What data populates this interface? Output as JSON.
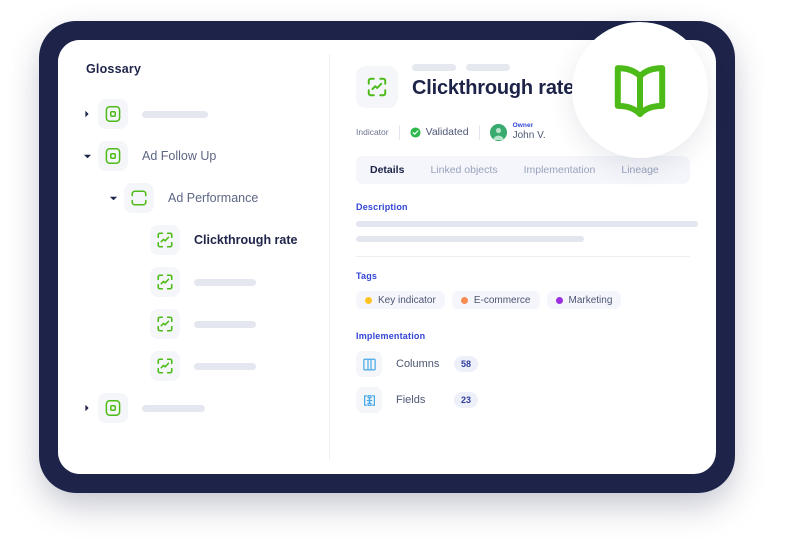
{
  "window": {
    "frame_color": "#1e2449",
    "surface_color": "#ffffff"
  },
  "badge": {
    "icon": "open-book-icon",
    "icon_color": "#4cbb17"
  },
  "sidebar": {
    "title": "Glossary",
    "items": [
      {
        "label": "",
        "icon": "domain-square-icon",
        "level": 0,
        "caret": "right",
        "skeleton_width": 66,
        "active": false
      },
      {
        "label": "Ad Follow Up",
        "icon": "domain-square-icon",
        "level": 0,
        "caret": "down",
        "skeleton_width": 0,
        "active": false
      },
      {
        "label": "Ad Performance",
        "icon": "rounded-frame-icon",
        "level": 1,
        "caret": "down",
        "skeleton_width": 0,
        "active": false
      },
      {
        "label": "Clickthrough rate",
        "icon": "indicator-scan-icon",
        "level": 2,
        "caret": "none",
        "skeleton_width": 0,
        "active": true
      },
      {
        "label": "",
        "icon": "indicator-scan-icon",
        "level": 2,
        "caret": "none",
        "skeleton_width": 62,
        "active": false
      },
      {
        "label": "",
        "icon": "indicator-scan-icon",
        "level": 2,
        "caret": "none",
        "skeleton_width": 62,
        "active": false
      },
      {
        "label": "",
        "icon": "indicator-scan-icon",
        "level": 2,
        "caret": "none",
        "skeleton_width": 62,
        "active": false
      },
      {
        "label": "",
        "icon": "domain-square-icon",
        "level": 0,
        "caret": "right",
        "skeleton_width": 63,
        "active": false
      }
    ],
    "icon_color": "#4cbb17"
  },
  "entity": {
    "icon": "indicator-scan-icon",
    "breadcrumb_skeletons": [
      44,
      44
    ],
    "title": "Clickthrough rate",
    "type_label": "Indicator",
    "status_label": "Validated",
    "status_color": "#2db84c",
    "owner_label": "Owner",
    "owner_name": "John V.",
    "owner_label_color": "#2f46d8"
  },
  "tabs": [
    {
      "label": "Details",
      "active": true
    },
    {
      "label": "Linked objects",
      "active": false
    },
    {
      "label": "Implementation",
      "active": false
    },
    {
      "label": "Lineage",
      "active": false
    }
  ],
  "description": {
    "label": "Description",
    "lines": [
      342,
      228
    ]
  },
  "tags": {
    "label": "Tags",
    "items": [
      {
        "label": "Key indicator",
        "color": "#ffc324"
      },
      {
        "label": "E-commerce",
        "color": "#f98c53"
      },
      {
        "label": "Marketing",
        "color": "#9b2ee0"
      }
    ]
  },
  "implementation": {
    "label": "Implementation",
    "rows": [
      {
        "label": "Columns",
        "count": "58",
        "icon": "columns-icon"
      },
      {
        "label": "Fields",
        "count": "23",
        "icon": "fields-node-icon"
      }
    ],
    "icon_color": "#4aa9e8"
  }
}
